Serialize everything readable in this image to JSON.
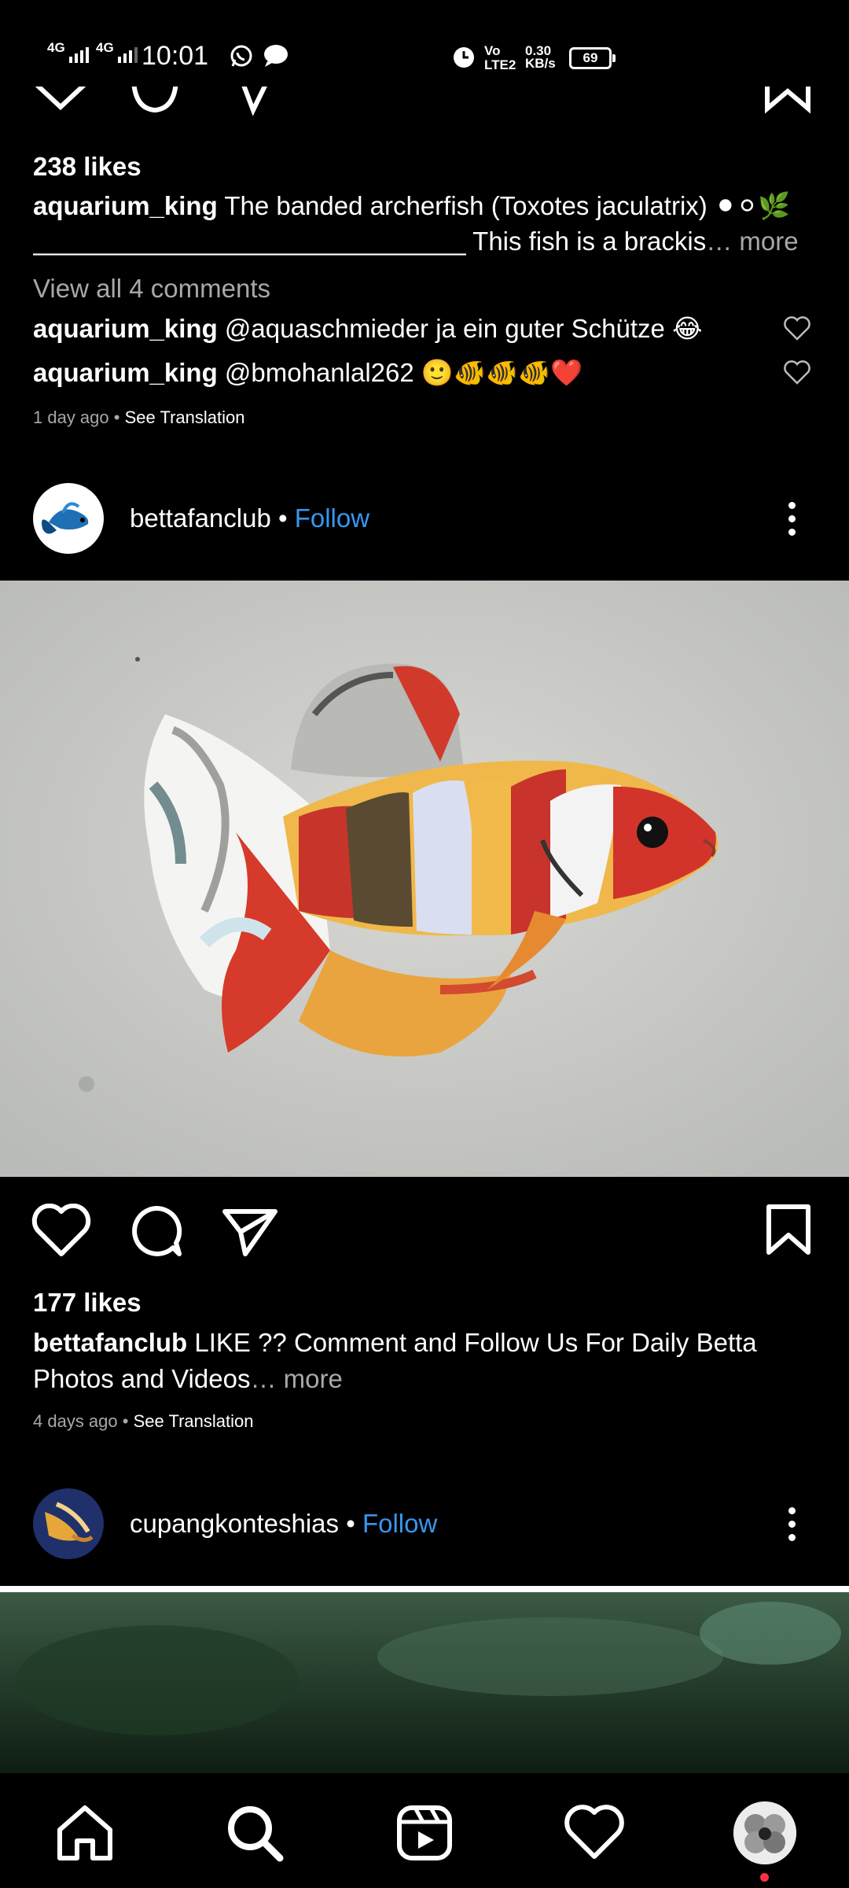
{
  "status_bar": {
    "network1": "4G",
    "network2": "4G",
    "time": "10:01",
    "volte": "Vo LTE2",
    "speed_value": "0.30",
    "speed_unit": "KB/s",
    "battery": "69"
  },
  "post1": {
    "likes": "238 likes",
    "caption_user": "aquarium_king",
    "caption_text": "The banded archerfish (Toxotes jaculatrix) ⚫⚪🌿",
    "caption_line2": "______________________________ This fish is a brackis",
    "caption_more": "… more",
    "view_comments": "View all 4 comments",
    "comments": [
      {
        "user": "aquarium_king",
        "text": "@aquaschmieder ja ein guter Schütze 😂"
      },
      {
        "user": "aquarium_king",
        "text": "@bmohanlal262 🙂🐠🐠🐠❤️"
      }
    ],
    "time": "1 day ago",
    "translation": "See Translation"
  },
  "post2": {
    "username": "bettafanclub",
    "separator": "•",
    "follow": "Follow",
    "likes": "177 likes",
    "caption_user": "bettafanclub",
    "caption_text": "LIKE ?? Comment and Follow Us For Daily Betta",
    "caption_line2": "Photos and Videos",
    "caption_more": "… more",
    "time": "4 days ago",
    "translation": "See Translation"
  },
  "post3": {
    "username": "cupangkonteshias",
    "separator": "•",
    "follow": "Follow"
  },
  "nav": {
    "items": [
      "home-icon",
      "search-icon",
      "reels-icon",
      "heart-icon",
      "profile-avatar"
    ]
  },
  "colors": {
    "background": "#000000",
    "text": "#ffffff",
    "secondary": "#a8a8a8",
    "link": "#3797f0",
    "badge": "#ff3040"
  }
}
